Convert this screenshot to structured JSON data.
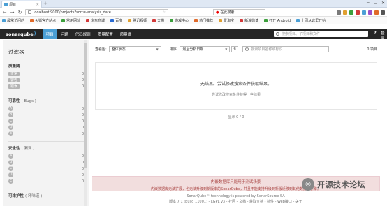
{
  "browser": {
    "tab_title": "项目",
    "url": "localhost:9000/projects?sort=-analysis_date",
    "search_engine_text": "在此搜索",
    "bookmarks": [
      "最常访问的",
      "火狐官方站点",
      "常用网址",
      "京东商城",
      "百度",
      "腾讯视频",
      "天猫",
      "游戏中心",
      "热门推荐",
      "爱淘宝",
      "新浪微博",
      "打开 Android",
      "上网从这里开始"
    ]
  },
  "sq": {
    "logo": "sonarqube",
    "menu": [
      {
        "label": "项目",
        "active": true
      },
      {
        "label": "问题",
        "active": false
      },
      {
        "label": "代码规则",
        "active": false
      },
      {
        "label": "质量配置",
        "active": false
      },
      {
        "label": "质量阈",
        "active": false
      }
    ],
    "search_placeholder": "搜索项目、子项目和文件",
    "help": "?",
    "login": "登录"
  },
  "filters": {
    "title": "过滤器",
    "quality_gate": {
      "heading": "质量阈",
      "items": [
        {
          "label": "正常",
          "count": "0"
        },
        {
          "label": "警告",
          "count": "0"
        },
        {
          "label": "错误",
          "count": "0"
        }
      ]
    },
    "reliability": {
      "heading": "可靠性",
      "sub": "( Bugs )",
      "items": [
        {
          "label": "A",
          "count": "0"
        },
        {
          "label": "B",
          "count": "0"
        },
        {
          "label": "C",
          "count": "0"
        },
        {
          "label": "D",
          "count": "0"
        },
        {
          "label": "E",
          "count": "0"
        }
      ]
    },
    "security": {
      "heading": "安全性",
      "sub": "( 漏洞 )",
      "items": [
        {
          "label": "A",
          "count": "0"
        },
        {
          "label": "B",
          "count": "0"
        },
        {
          "label": "C",
          "count": "0"
        },
        {
          "label": "D",
          "count": "0"
        },
        {
          "label": "E",
          "count": "0"
        }
      ]
    },
    "maintainability": {
      "heading": "可维护性",
      "sub": "( 坏味道 )"
    }
  },
  "toolbar": {
    "view_label": "查看图:",
    "view_value": "整体状态",
    "sort_label": "排序:",
    "sort_value": "最后分析日期",
    "search_placeholder": "搜索项目名称或标识",
    "project_count": "0 项目"
  },
  "empty": {
    "title": "无结果。尝试修改搜索条件获取结果。",
    "hint": "尝试修改搜索条件获得一些结果"
  },
  "pager": "显示 0 / 0",
  "footer": {
    "warning_title": "内嵌数据库只能用于测试场景",
    "warning_body": "内嵌数据库无法扩展，也无法升级到新版本的SonarQube，并且不能支持升级到新版迁移到其他数据库引擎。",
    "line1": "SonarQube™ technology is powered by SonarSource SA",
    "line2": "版本 7.1 (build 11001) - LGPL v3 - 社区 - 文档 - 获取支持 - 插件 - Web接口 - 关于"
  },
  "watermark": "开源技术论坛"
}
